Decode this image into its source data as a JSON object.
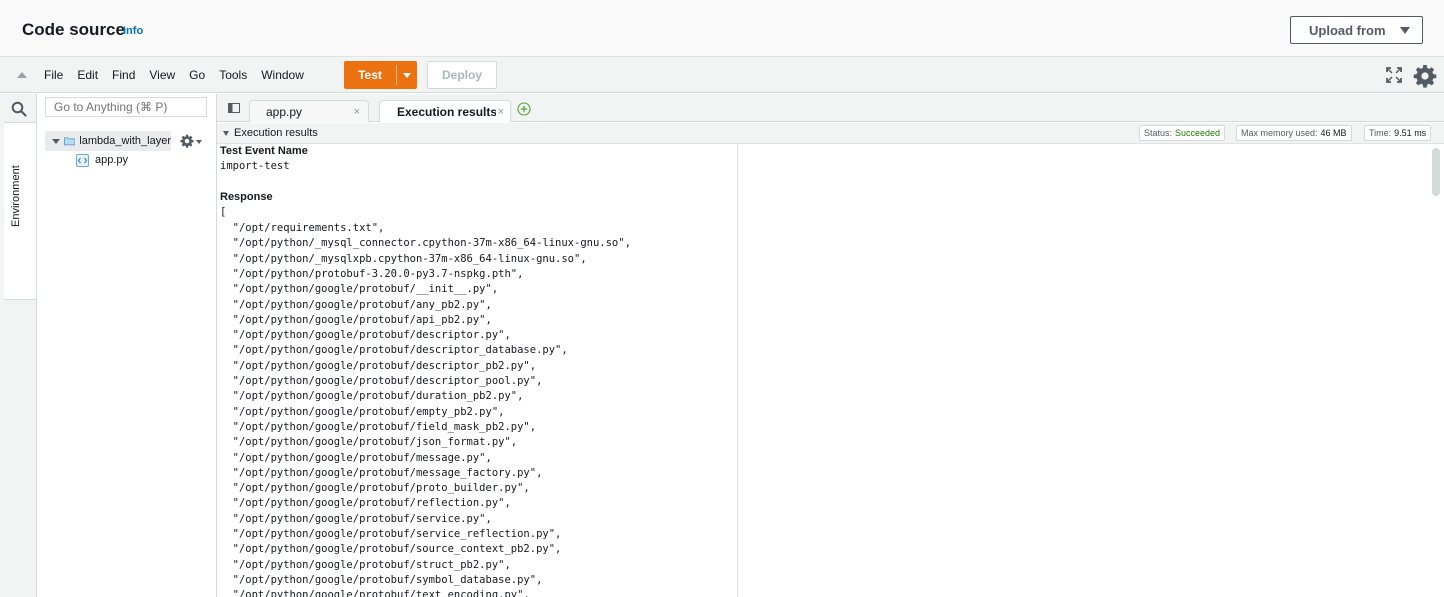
{
  "header": {
    "title": "Code source",
    "info_link": "Info",
    "upload_button": "Upload from"
  },
  "toolbar": {
    "menu": [
      "File",
      "Edit",
      "Find",
      "View",
      "Go",
      "Tools",
      "Window"
    ],
    "test_button": "Test",
    "deploy_button": "Deploy"
  },
  "sidebar": {
    "search_placeholder": "Go to Anything (⌘ P)",
    "environment_tab": "Environment",
    "folder": "lambda_with_layer",
    "file": "app.py"
  },
  "tabs": [
    {
      "label": "app.py",
      "close": "×"
    },
    {
      "label": "Execution results",
      "close": "×"
    }
  ],
  "exec": {
    "panel_title": "Execution results",
    "status_label": "Status:",
    "status_value": "Succeeded",
    "memory_label": "Max memory used:",
    "memory_value": "46 MB",
    "time_label": "Time:",
    "time_value": "9.51 ms"
  },
  "result": {
    "event_name_label": "Test Event Name",
    "event_name": "import-test",
    "response_label": "Response",
    "open_bracket": "[",
    "lines": [
      "  \"/opt/requirements.txt\",",
      "  \"/opt/python/_mysql_connector.cpython-37m-x86_64-linux-gnu.so\",",
      "  \"/opt/python/_mysqlxpb.cpython-37m-x86_64-linux-gnu.so\",",
      "  \"/opt/python/protobuf-3.20.0-py3.7-nspkg.pth\",",
      "  \"/opt/python/google/protobuf/__init__.py\",",
      "  \"/opt/python/google/protobuf/any_pb2.py\",",
      "  \"/opt/python/google/protobuf/api_pb2.py\",",
      "  \"/opt/python/google/protobuf/descriptor.py\",",
      "  \"/opt/python/google/protobuf/descriptor_database.py\",",
      "  \"/opt/python/google/protobuf/descriptor_pb2.py\",",
      "  \"/opt/python/google/protobuf/descriptor_pool.py\",",
      "  \"/opt/python/google/protobuf/duration_pb2.py\",",
      "  \"/opt/python/google/protobuf/empty_pb2.py\",",
      "  \"/opt/python/google/protobuf/field_mask_pb2.py\",",
      "  \"/opt/python/google/protobuf/json_format.py\",",
      "  \"/opt/python/google/protobuf/message.py\",",
      "  \"/opt/python/google/protobuf/message_factory.py\",",
      "  \"/opt/python/google/protobuf/proto_builder.py\",",
      "  \"/opt/python/google/protobuf/reflection.py\",",
      "  \"/opt/python/google/protobuf/service.py\",",
      "  \"/opt/python/google/protobuf/service_reflection.py\",",
      "  \"/opt/python/google/protobuf/source_context_pb2.py\",",
      "  \"/opt/python/google/protobuf/struct_pb2.py\",",
      "  \"/opt/python/google/protobuf/symbol_database.py\",",
      "  \"/opt/python/google/protobuf/text_encoding.py\","
    ]
  }
}
